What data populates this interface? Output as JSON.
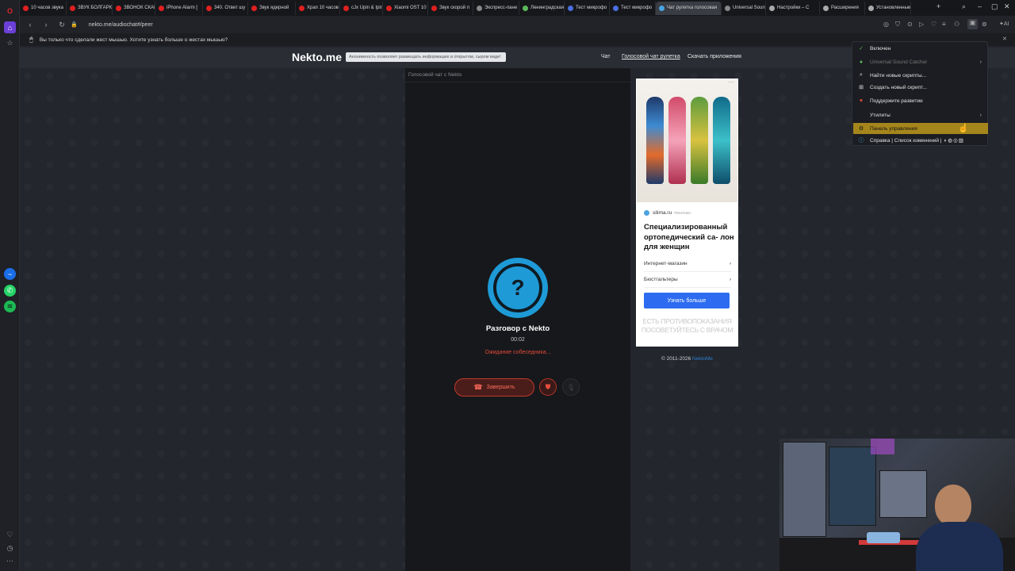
{
  "tabs": [
    {
      "label": "10 часов звука",
      "color": "#e02020",
      "active": false
    },
    {
      "label": "ЗВУК БОЛГАРК",
      "color": "#e02020",
      "active": false
    },
    {
      "label": "ЗВОНОК СКАЙ",
      "color": "#e02020",
      "active": false
    },
    {
      "label": "iPhone Alarm [",
      "color": "#e02020",
      "active": false
    },
    {
      "label": "340. Ответ шу",
      "color": "#e02020",
      "active": false
    },
    {
      "label": "Звук ядерной",
      "color": "#e02020",
      "active": false
    },
    {
      "label": "Храп 10 часов",
      "color": "#e02020",
      "active": false
    },
    {
      "label": "cJx Upin & Ipin",
      "color": "#e02020",
      "active": false
    },
    {
      "label": "Xiaomi OST 10",
      "color": "#e02020",
      "active": false
    },
    {
      "label": "Звук скорой п",
      "color": "#e02020",
      "active": false
    },
    {
      "label": "Экспресс-пане",
      "color": "#888888",
      "active": false
    },
    {
      "label": "Ленинградская",
      "color": "#5cb85c",
      "active": false
    },
    {
      "label": "Тест микрофо",
      "color": "#4a6fe0",
      "active": false
    },
    {
      "label": "Тест микрофо",
      "color": "#4a6fe0",
      "active": false
    },
    {
      "label": "Чат рулетка голосовая",
      "color": "#4aa3df",
      "active": true
    },
    {
      "label": "Universal Sound",
      "color": "#888888",
      "active": false
    },
    {
      "label": "Настройки – С",
      "color": "#aaaaaa",
      "active": false
    },
    {
      "label": "Расширения",
      "color": "#aaaaaa",
      "active": false
    },
    {
      "label": "Установленные",
      "color": "#aaaaaa",
      "active": false
    }
  ],
  "address": {
    "url": "nekto.me/audiochat#/peer"
  },
  "notification": {
    "text": "Вы только что сделали жест мышью. Хотите узнать больше о жестах мышью?"
  },
  "site": {
    "logo": "Nekto.me",
    "anon_notice": "Анонимность позволяет размещать информацию в открытом, сыром виде!",
    "nav": [
      "Чат",
      "Голосовой чат рулетка",
      "Скачать приложения"
    ]
  },
  "chat": {
    "header": "Голосовой чат с Nekto",
    "question_mark": "?",
    "title": "Разговор с Nekto",
    "timer": "00:02",
    "status": "Ожидание собеседника...",
    "end_button": "Завершить"
  },
  "ad": {
    "source": "silima.ru",
    "source_tag": "РЕКЛАМА",
    "title": "Специализированный ортопедический са- лон для женщин",
    "links": [
      "Интернет-магазин",
      "Бюстгальтеры"
    ],
    "button": "Узнать больше",
    "warning": "ЕСТЬ ПРОТИВОПОКАЗАНИЯ ПОСОВЕТУЙТЕСЬ С ВРАЧОМ"
  },
  "copyright": {
    "text": "© 2011-2026",
    "link": "NektoMe"
  },
  "menu": {
    "items": [
      {
        "label": "Включен",
        "icon": "check-icon"
      },
      {
        "label": "Universal Sound Catcher",
        "icon": "toggle-icon"
      },
      {
        "label": "Найти новые скрипты...",
        "icon": "search-icon"
      },
      {
        "label": "Создать новый скрипт...",
        "icon": "plus-icon"
      },
      {
        "label": "Поддержите развитие",
        "icon": "heart-icon"
      },
      {
        "label": "Утилиты",
        "icon": ""
      },
      {
        "label": "Панель управления",
        "icon": "gear-icon"
      },
      {
        "label": "Справка | Список изменений |",
        "icon": "info-icon"
      }
    ]
  },
  "colors": {
    "accent_blue": "#1e9ad6",
    "danger_red": "#e04a3a",
    "menu_highlight": "#a5861c",
    "ad_button": "#2d6cf0"
  }
}
